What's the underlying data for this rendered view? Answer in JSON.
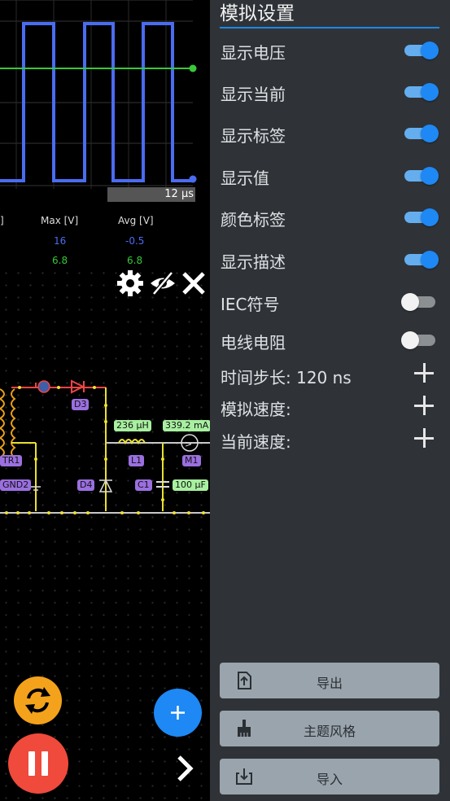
{
  "scope": {
    "time_label": "12 μs",
    "columns": [
      {
        "header": "]",
        "v1": "",
        "v2": ""
      },
      {
        "header": "Max [V]",
        "v1": "16",
        "v2": "6.8"
      },
      {
        "header": "Avg [V]",
        "v1": "-0.5",
        "v2": "6.8"
      }
    ],
    "colors": {
      "voltage": "#4a6cf0",
      "current": "#38c838"
    }
  },
  "toolbar_icons": [
    "gear-icon",
    "eye-off-icon",
    "close-icon"
  ],
  "circuit": {
    "components": [
      "D3",
      "TR1",
      "GND2",
      "D4",
      "L1",
      "C1",
      "M1"
    ],
    "values": [
      "236 μH",
      "339.2 mA",
      "100 μF"
    ]
  },
  "panel": {
    "title": "模拟设置",
    "toggles": [
      {
        "label": "显示电压",
        "on": true
      },
      {
        "label": "显示当前",
        "on": true
      },
      {
        "label": "显示标签",
        "on": true
      },
      {
        "label": "显示值",
        "on": true
      },
      {
        "label": "颜色标签",
        "on": true
      },
      {
        "label": "显示描述",
        "on": true
      },
      {
        "label": "IEC符号",
        "on": false
      },
      {
        "label": "电线电阻",
        "on": false
      }
    ],
    "steppers": [
      {
        "label": "时间步长: 120 ns"
      },
      {
        "label": "模拟速度:"
      },
      {
        "label": "当前速度:"
      }
    ],
    "buttons": [
      {
        "label": "导出",
        "icon": "export-icon"
      },
      {
        "label": "主题风格",
        "icon": "brush-icon"
      },
      {
        "label": "导入",
        "icon": "import-icon"
      }
    ]
  },
  "fab": {
    "reset_icon": "sync-icon",
    "pause_icon": "pause-icon",
    "add_icon": "plus-icon",
    "next_icon": "chevron-right-icon"
  }
}
